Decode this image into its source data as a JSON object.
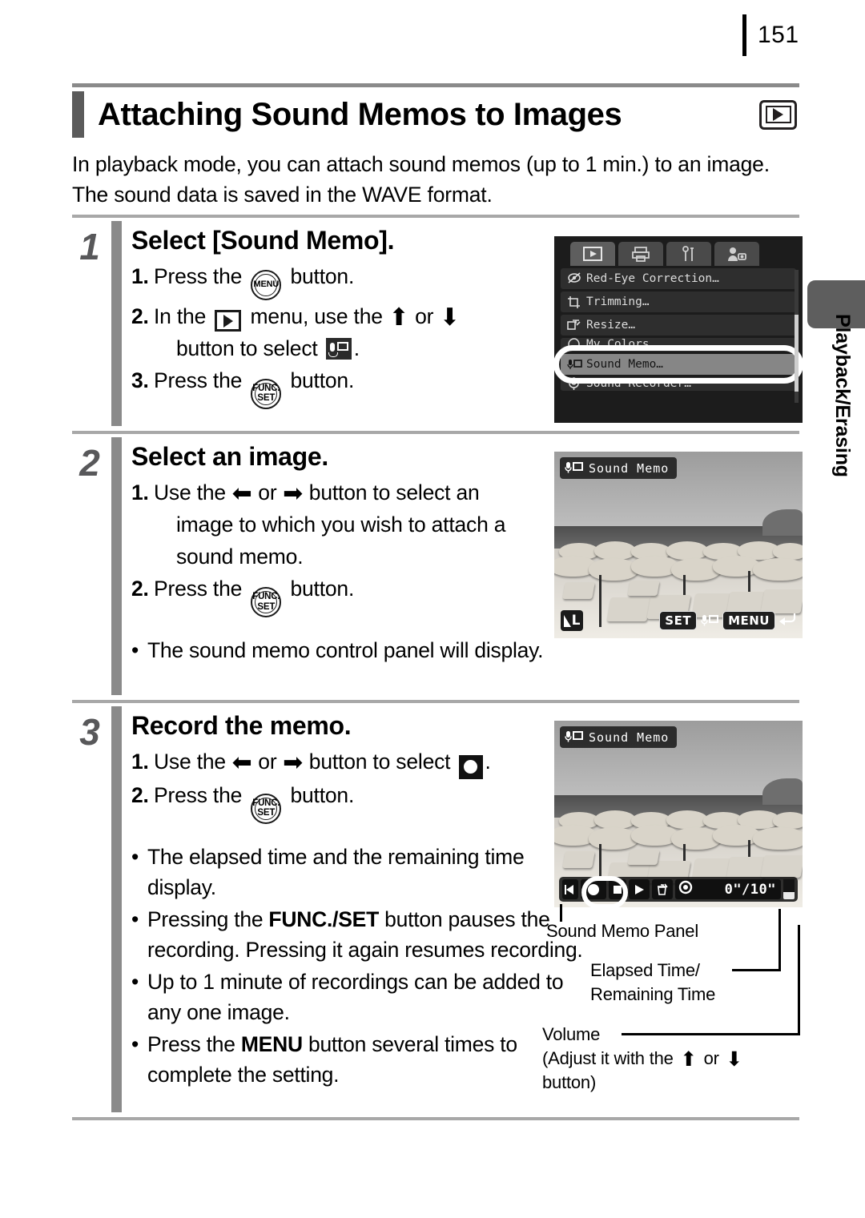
{
  "page": {
    "number": "151",
    "side_tab_label": "Playback/Erasing"
  },
  "header": {
    "title": "Attaching Sound Memos to Images",
    "badge_icon": "playback-mode-icon"
  },
  "intro": "In playback mode, you can attach sound memos (up to 1 min.) to an image. The sound data is saved in the WAVE format.",
  "steps": [
    {
      "number": "1",
      "title": "Select [Sound Memo].",
      "lines": [
        {
          "marker": "1.",
          "pre": "Press the",
          "icon": "menu-button-icon",
          "post": "button."
        },
        {
          "marker": "2.",
          "pre": "In the",
          "icon": "playback-menu-icon",
          "mid": "menu, use the",
          "arrows": "up-or-down",
          "post": "button to select",
          "icon2": "sound-memo-icon",
          "end": "."
        },
        {
          "marker": "3.",
          "pre": "Press the",
          "icon": "func-set-button-icon",
          "post": "button."
        }
      ],
      "screen": {
        "type": "camera-menu",
        "tabs": [
          "playback-tab",
          "print-tab",
          "setup-tab",
          "my-camera-tab"
        ],
        "active_tab_index": 0,
        "items": [
          {
            "label": "Red-Eye Correction…",
            "icon": "red-eye-icon",
            "selected": false
          },
          {
            "label": "Trimming…",
            "icon": "trimming-icon",
            "selected": false
          },
          {
            "label": "Resize…",
            "icon": "resize-icon",
            "selected": false
          },
          {
            "label": "My Colors…",
            "icon": "my-colors-icon",
            "selected": false
          },
          {
            "label": "Sound Memo…",
            "icon": "sound-memo-icon",
            "selected": true
          },
          {
            "label": "Sound Recorder…",
            "icon": "sound-recorder-icon",
            "selected": false
          }
        ]
      }
    },
    {
      "number": "2",
      "title": "Select an image.",
      "lines": [
        {
          "marker": "1.",
          "pre": "Use the",
          "arrows": "left-or-right",
          "post": "button to select an",
          "cont1": "image to which you wish to attach a",
          "cont2": "sound memo."
        },
        {
          "marker": "2.",
          "pre": "Press the",
          "icon": "func-set-button-icon",
          "post": "button."
        }
      ],
      "bullets": [
        "The sound memo control panel will display."
      ],
      "screen": {
        "type": "photo-preview",
        "overlay_label": "Sound Memo",
        "quality_badge": "superfine-L",
        "hint_set": "SET",
        "hint_menu": "MENU"
      }
    },
    {
      "number": "3",
      "title": "Record the memo.",
      "lines": [
        {
          "marker": "1.",
          "pre": "Use the",
          "arrows": "left-or-right",
          "post": "button to select",
          "icon2": "record-icon",
          "end": "."
        },
        {
          "marker": "2.",
          "pre": "Press the",
          "icon": "func-set-button-icon",
          "post": "button."
        }
      ],
      "bullets": [
        "The elapsed time and the remaining time display.",
        "Pressing the FUNC./SET button pauses the recording. Pressing it again resumes recording.",
        "Up to 1 minute of recordings can be added to any one image.",
        "Press the MENU button several times to complete the setting."
      ],
      "screen": {
        "type": "photo-recording",
        "overlay_label": "Sound Memo",
        "panel_icons": [
          "exit-icon",
          "record-icon",
          "stop-icon",
          "play-icon",
          "erase-icon",
          "time-icon"
        ],
        "time_display": "0\"/10\"",
        "selected_panel_icon": "record-icon"
      }
    }
  ],
  "callouts": {
    "panel": "Sound Memo Panel",
    "time_line1": "Elapsed Time/",
    "time_line2": "Remaining Time",
    "volume_label": "Volume",
    "volume_note1": "(Adjust it with the",
    "volume_note_or": "or",
    "volume_note2": "button)"
  },
  "bold_terms": {
    "func_set": "FUNC./SET",
    "menu": "MENU"
  }
}
